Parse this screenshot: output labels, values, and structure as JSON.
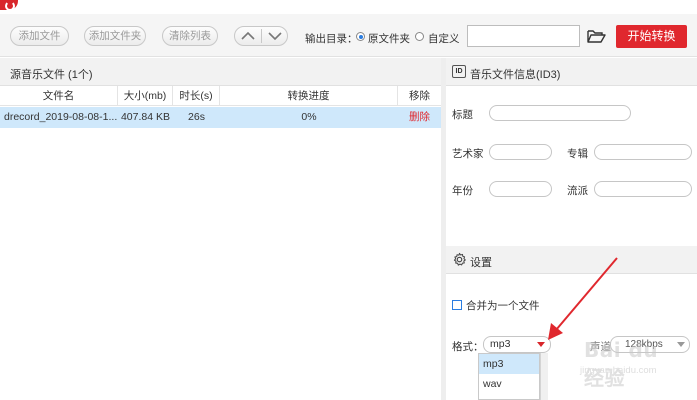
{
  "toolbar": {
    "add_file": "添加文件",
    "add_folder": "添加文件夹",
    "clear_list": "清除列表",
    "output_label": "输出目录：",
    "radio_source": "原文件夹",
    "radio_custom": "自定义",
    "path_value": "",
    "start_button": "开始转换"
  },
  "file_list": {
    "title": "源音乐文件 (1个)",
    "columns": [
      "文件名",
      "大小(mb)",
      "时长(s)",
      "转换进度",
      "移除"
    ],
    "rows": [
      {
        "name": "drecord_2019-08-08-1...",
        "size": "407.84 KB",
        "duration": "26s",
        "progress": "0%",
        "remove": "删除"
      }
    ]
  },
  "id3": {
    "title": "音乐文件信息(ID3)",
    "icon_text": "ID",
    "title_label": "标题",
    "artist_label": "艺术家",
    "album_label": "专辑",
    "year_label": "年份",
    "genre_label": "流派"
  },
  "settings": {
    "title": "设置",
    "merge_label": "合并为一个文件",
    "format_label": "格式：",
    "format_value": "mp3",
    "format_options": [
      "mp3",
      "wav"
    ],
    "bitrate_label": "声道",
    "bitrate_value": "128kbps"
  },
  "watermark": {
    "logo": "Bai du 经验",
    "url": "jingyan.baidu.com"
  },
  "colors": {
    "accent_red": "#e0282e",
    "selected_row": "#cfe8fb",
    "panel_header": "#f2f2f2"
  }
}
